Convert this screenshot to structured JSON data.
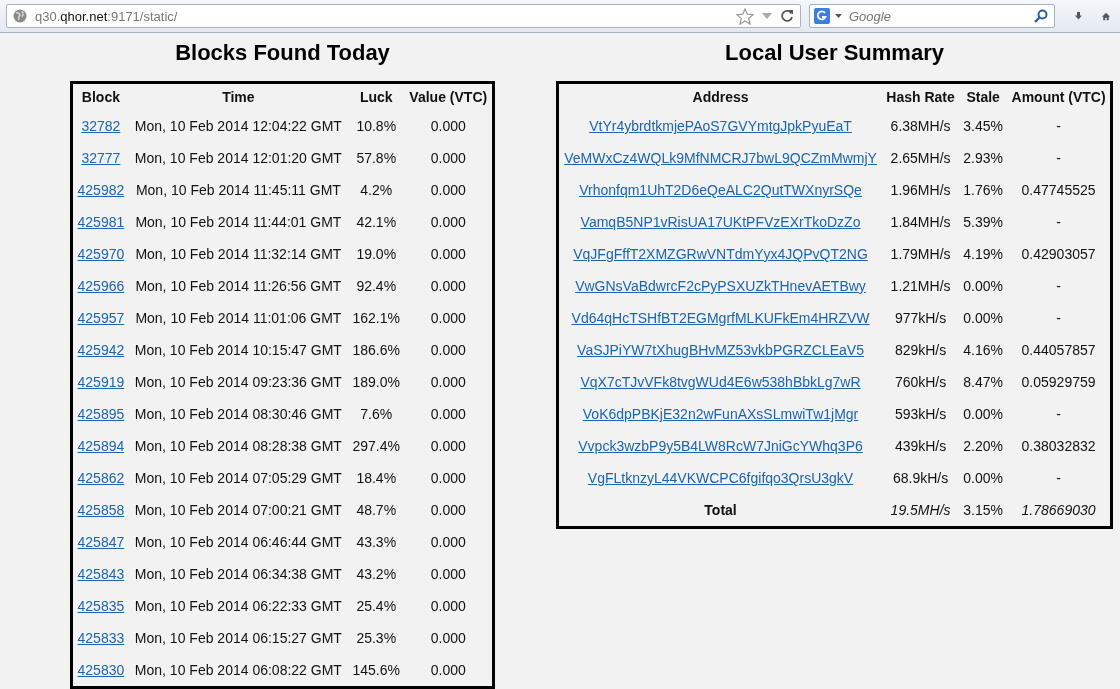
{
  "browser": {
    "url": "q30.**qhor.net**:9171/static/",
    "search": {
      "placeholder": "Google"
    }
  },
  "blocks": {
    "title": "Blocks Found Today",
    "columns": [
      "Block",
      "Time",
      "Luck",
      "Value (VTC)"
    ],
    "rows": [
      {
        "block": "32782",
        "time": "Mon, 10 Feb 2014 12:04:22 GMT",
        "luck": "10.8%",
        "value": "0.000"
      },
      {
        "block": "32777",
        "time": "Mon, 10 Feb 2014 12:01:20 GMT",
        "luck": "57.8%",
        "value": "0.000"
      },
      {
        "block": "425982",
        "time": "Mon, 10 Feb 2014 11:45:11 GMT",
        "luck": "4.2%",
        "value": "0.000"
      },
      {
        "block": "425981",
        "time": "Mon, 10 Feb 2014 11:44:01 GMT",
        "luck": "42.1%",
        "value": "0.000"
      },
      {
        "block": "425970",
        "time": "Mon, 10 Feb 2014 11:32:14 GMT",
        "luck": "19.0%",
        "value": "0.000"
      },
      {
        "block": "425966",
        "time": "Mon, 10 Feb 2014 11:26:56 GMT",
        "luck": "92.4%",
        "value": "0.000"
      },
      {
        "block": "425957",
        "time": "Mon, 10 Feb 2014 11:01:06 GMT",
        "luck": "162.1%",
        "value": "0.000"
      },
      {
        "block": "425942",
        "time": "Mon, 10 Feb 2014 10:15:47 GMT",
        "luck": "186.6%",
        "value": "0.000"
      },
      {
        "block": "425919",
        "time": "Mon, 10 Feb 2014 09:23:36 GMT",
        "luck": "189.0%",
        "value": "0.000"
      },
      {
        "block": "425895",
        "time": "Mon, 10 Feb 2014 08:30:46 GMT",
        "luck": "7.6%",
        "value": "0.000"
      },
      {
        "block": "425894",
        "time": "Mon, 10 Feb 2014 08:28:38 GMT",
        "luck": "297.4%",
        "value": "0.000"
      },
      {
        "block": "425862",
        "time": "Mon, 10 Feb 2014 07:05:29 GMT",
        "luck": "18.4%",
        "value": "0.000"
      },
      {
        "block": "425858",
        "time": "Mon, 10 Feb 2014 07:00:21 GMT",
        "luck": "48.7%",
        "value": "0.000"
      },
      {
        "block": "425847",
        "time": "Mon, 10 Feb 2014 06:46:44 GMT",
        "luck": "43.3%",
        "value": "0.000"
      },
      {
        "block": "425843",
        "time": "Mon, 10 Feb 2014 06:34:38 GMT",
        "luck": "43.2%",
        "value": "0.000"
      },
      {
        "block": "425835",
        "time": "Mon, 10 Feb 2014 06:22:33 GMT",
        "luck": "25.4%",
        "value": "0.000"
      },
      {
        "block": "425833",
        "time": "Mon, 10 Feb 2014 06:15:27 GMT",
        "luck": "25.3%",
        "value": "0.000"
      },
      {
        "block": "425830",
        "time": "Mon, 10 Feb 2014 06:08:22 GMT",
        "luck": "145.6%",
        "value": "0.000"
      }
    ]
  },
  "users": {
    "title": "Local User Summary",
    "columns": [
      "Address",
      "Hash Rate",
      "Stale",
      "Amount (VTC)"
    ],
    "rows": [
      {
        "address": "VtYr4ybrdtkmjePAoS7GVYmtgJpkPyuEaT",
        "hash_rate": "6.38MH/s",
        "stale": "3.45%",
        "amount": "-"
      },
      {
        "address": "VeMWxCz4WQLk9MfNMCRJ7bwL9QCZmMwmjY",
        "hash_rate": "2.65MH/s",
        "stale": "2.93%",
        "amount": "-"
      },
      {
        "address": "Vrhonfqm1UhT2D6eQeALC2QutTWXnyrSQe",
        "hash_rate": "1.96MH/s",
        "stale": "1.76%",
        "amount": "0.47745525"
      },
      {
        "address": "VamqB5NP1vRisUA17UKtPFVzEXrTkoDzZo",
        "hash_rate": "1.84MH/s",
        "stale": "5.39%",
        "amount": "-"
      },
      {
        "address": "VqJFgFffT2XMZGRwVNTdmYyx4JQPvQT2NG",
        "hash_rate": "1.79MH/s",
        "stale": "4.19%",
        "amount": "0.42903057"
      },
      {
        "address": "VwGNsVaBdwrcF2cPyPSXUZkTHnevAETBwy",
        "hash_rate": "1.21MH/s",
        "stale": "0.00%",
        "amount": "-"
      },
      {
        "address": "Vd64qHcTSHfBT2EGMgrfMLKUFkEm4HRZVW",
        "hash_rate": "977kH/s",
        "stale": "0.00%",
        "amount": "-"
      },
      {
        "address": "VaSJPiYW7tXhugBHvMZ53vkbPGRZCLEaV5",
        "hash_rate": "829kH/s",
        "stale": "4.16%",
        "amount": "0.44057857"
      },
      {
        "address": "VqX7cTJvVFk8tvgWUd4E6w538hBbkLg7wR",
        "hash_rate": "760kH/s",
        "stale": "8.47%",
        "amount": "0.05929759"
      },
      {
        "address": "VoK6dpPBKjE32n2wFunAXsSLmwiTw1jMgr",
        "hash_rate": "593kH/s",
        "stale": "0.00%",
        "amount": "-"
      },
      {
        "address": "Vvpck3wzbP9y5B4LW8RcW7JniGcYWhq3P6",
        "hash_rate": "439kH/s",
        "stale": "2.20%",
        "amount": "0.38032832"
      },
      {
        "address": "VgFLtknzyL44VKWCPC6fgifqo3QrsU3gkV",
        "hash_rate": "68.9kH/s",
        "stale": "0.00%",
        "amount": "-"
      }
    ],
    "total": {
      "label": "Total",
      "hash_rate": "19.5MH/s",
      "stale": "3.15%",
      "amount": "1.78669030"
    }
  }
}
